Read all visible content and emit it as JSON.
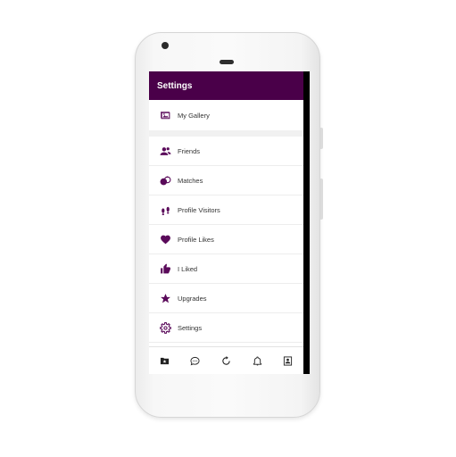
{
  "app": {
    "title": "Settings",
    "accent_color": "#4a0049",
    "icon_color": "#5a0a5a"
  },
  "menu": {
    "gallery": {
      "label": "My Gallery",
      "icon": "gallery-icon"
    },
    "items": [
      {
        "label": "Friends",
        "icon": "friends-icon"
      },
      {
        "label": "Matches",
        "icon": "matches-icon"
      },
      {
        "label": "Profile Visitors",
        "icon": "footprints-icon"
      },
      {
        "label": "Profile Likes",
        "icon": "heart-icon"
      },
      {
        "label": "I Liked",
        "icon": "thumbs-up-icon"
      },
      {
        "label": "Upgrades",
        "icon": "star-icon"
      },
      {
        "label": "Settings",
        "icon": "gear-icon"
      }
    ]
  },
  "bottom_nav": [
    {
      "icon": "folder-star-icon"
    },
    {
      "icon": "chat-icon"
    },
    {
      "icon": "refresh-icon"
    },
    {
      "icon": "bell-icon"
    },
    {
      "icon": "profile-card-icon"
    }
  ]
}
